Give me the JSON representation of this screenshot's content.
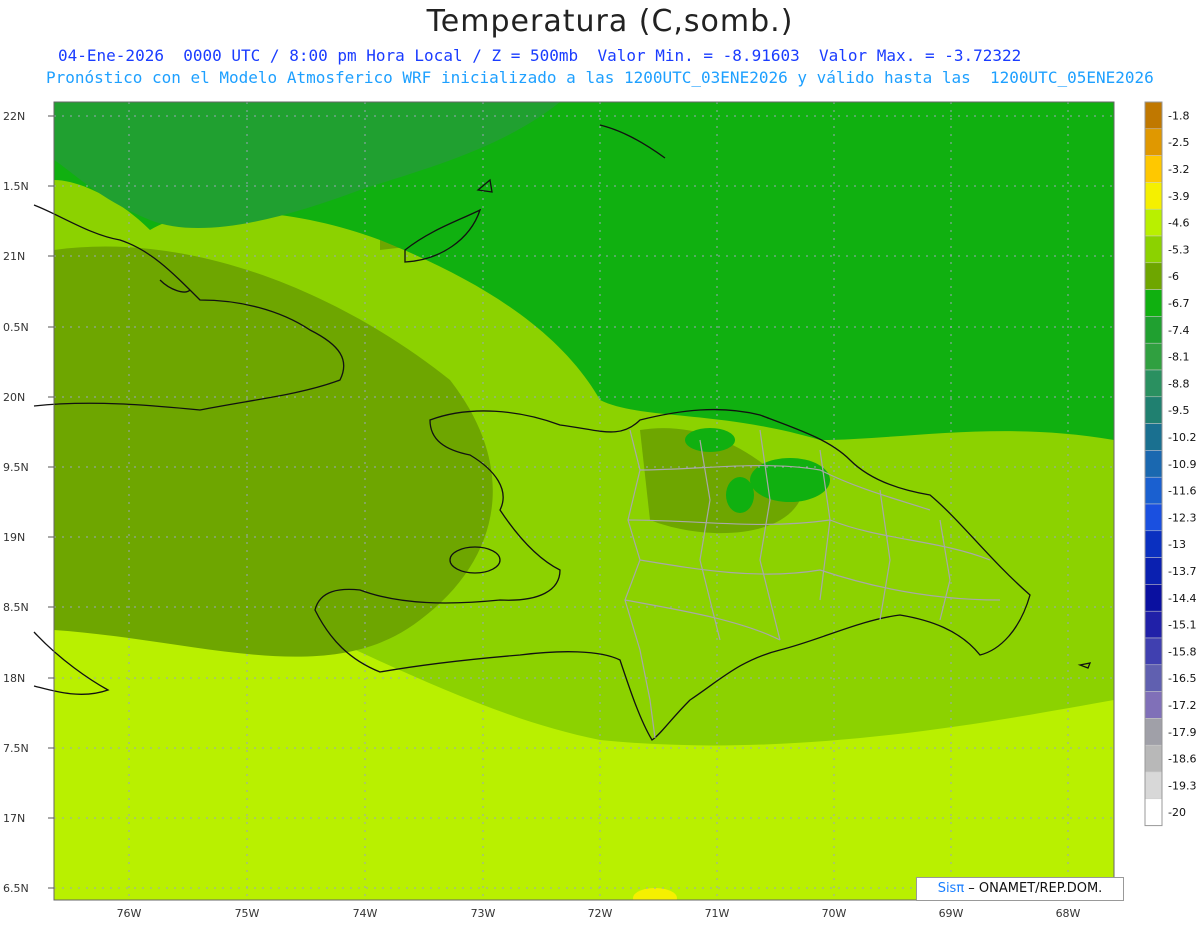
{
  "header": {
    "title": "Temperatura (C,somb.)",
    "line1": "04-Ene-2026  0000 UTC / 8:00 pm Hora Local / Z = 500mb  Valor Min. = -8.91603  Valor Max. = -3.72322",
    "line2": "Pronóstico con el Modelo Atmosferico WRF inicializado a las 1200UTC_03ENE2026 y válido hasta las  1200UTC_05ENE2026"
  },
  "axes": {
    "lat_labels": [
      "22N",
      "1.5N",
      "21N",
      "0.5N",
      "20N",
      "9.5N",
      "19N",
      "8.5N",
      "18N",
      "7.5N",
      "17N",
      "6.5N"
    ],
    "lon_labels": [
      "76W",
      "75W",
      "74W",
      "73W",
      "72W",
      "71W",
      "70W",
      "69W",
      "68W"
    ]
  },
  "colorbar": {
    "labels": [
      "-1.8",
      "-2.5",
      "-3.2",
      "-3.9",
      "-4.6",
      "-5.3",
      "-6",
      "-6.7",
      "-7.4",
      "-8.1",
      "-8.8",
      "-9.5",
      "-10.2",
      "-10.9",
      "-11.6",
      "-12.3",
      "-13",
      "-13.7",
      "-14.4",
      "-15.1",
      "-15.8",
      "-16.5",
      "-17.2",
      "-17.9",
      "-18.6",
      "-19.3",
      "-20"
    ],
    "colors": [
      "#c07800",
      "#e09800",
      "#ffc800",
      "#f5f000",
      "#b9f000",
      "#8cd200",
      "#6ea600",
      "#10b010",
      "#20a030",
      "#30a040",
      "#2a9060",
      "#208070",
      "#1a7090",
      "#1a68b0",
      "#1a60d0",
      "#1a50e0",
      "#0a30c0",
      "#0a20b0",
      "#0a10a0",
      "#2020a8",
      "#4040b0",
      "#6060b0",
      "#8070b8",
      "#a0a0a8",
      "#b8b8b8",
      "#d8d8d8",
      "#ffffff"
    ]
  },
  "credit": {
    "brand": "Sisπ",
    "text": " –  ONAMET/REP.DOM."
  }
}
